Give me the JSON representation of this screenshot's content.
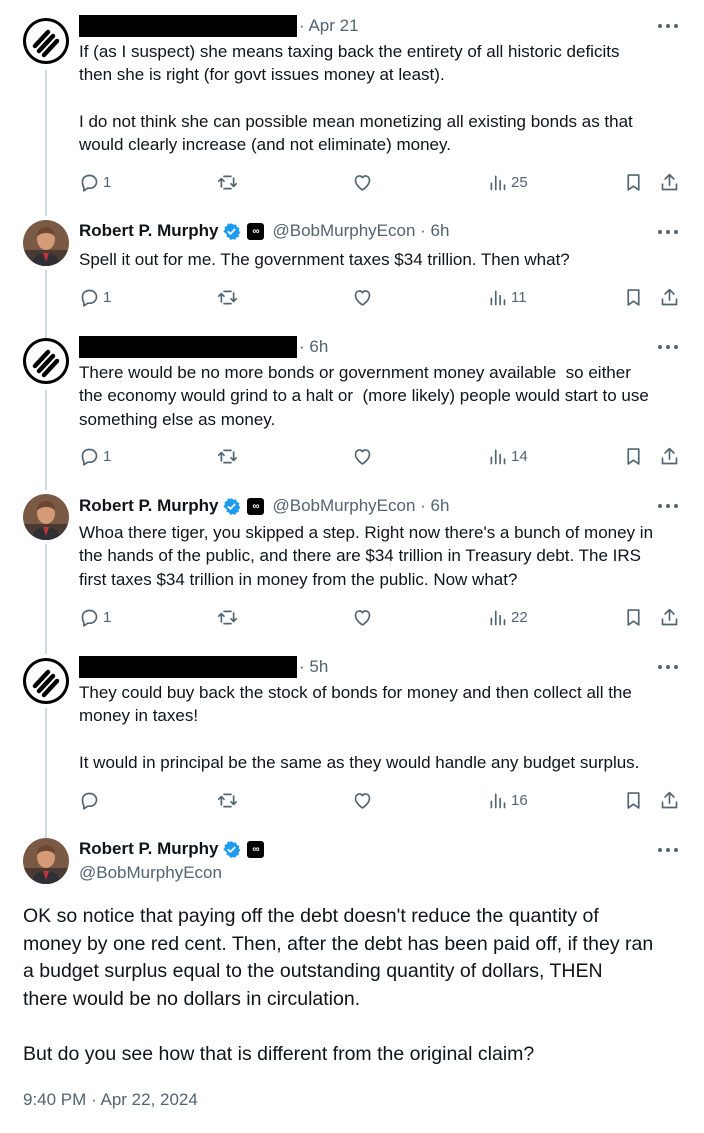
{
  "tweets": [
    {
      "handle_text": "· Apr 21",
      "text": "If (as I suspect) she means taxing back the entirety of all historic deficits\nthen she is right (for govt issues money at least).\n\nI do not think she can possible mean monetizing all existing bonds as that\nwould clearly increase (and not eliminate) money.",
      "replies": "1",
      "views": "25"
    },
    {
      "name": "Robert P. Murphy",
      "handle_text": "@BobMurphyEcon · 6h",
      "text": "Spell it out for me. The government taxes $34 trillion. Then what?",
      "replies": "1",
      "views": "11"
    },
    {
      "handle_text": "· 6h",
      "text": "There would be no more bonds or government money available  so either\nthe economy would grind to a halt or  (more likely) people would start to use\nsomething else as money.",
      "replies": "1",
      "views": "14"
    },
    {
      "name": "Robert P. Murphy",
      "handle_text": "@BobMurphyEcon · 6h",
      "text": "Whoa there tiger, you skipped a step. Right now there's a bunch of money in\nthe hands of the public, and there are $34 trillion in Treasury debt. The IRS\nfirst taxes $34 trillion in money from the public. Now what?",
      "replies": "1",
      "views": "22"
    },
    {
      "handle_text": "· 5h",
      "text": "They could buy back the stock of bonds for money and then collect all the\nmoney in taxes!\n\nIt would in principal be the same as they would handle any budget surplus.",
      "replies": "",
      "views": "16"
    }
  ],
  "main": {
    "name": "Robert P. Murphy",
    "handle": "@BobMurphyEcon",
    "text": "OK so notice that paying off the debt doesn't reduce the quantity of\nmoney by one red cent. Then, after the debt has been paid off, if they ran\na budget surplus equal to the outstanding quantity of dollars, THEN\nthere would be no dollars in circulation.\n\nBut do you see how that is different from the original claim?",
    "timestamp": "9:40 PM · Apr 22, 2024"
  },
  "icons": {
    "reply": "reply-icon",
    "retweet": "retweet-icon",
    "like": "heart-icon",
    "views": "views-icon",
    "bookmark": "bookmark-icon",
    "share": "share-icon",
    "more": "more-icon",
    "verified": "verified-badge-icon",
    "affiliate": "affiliate-badge-icon"
  },
  "colors": {
    "verified": "#1d9bf0",
    "muted": "#536471",
    "thread_line": "#cfd9de"
  }
}
